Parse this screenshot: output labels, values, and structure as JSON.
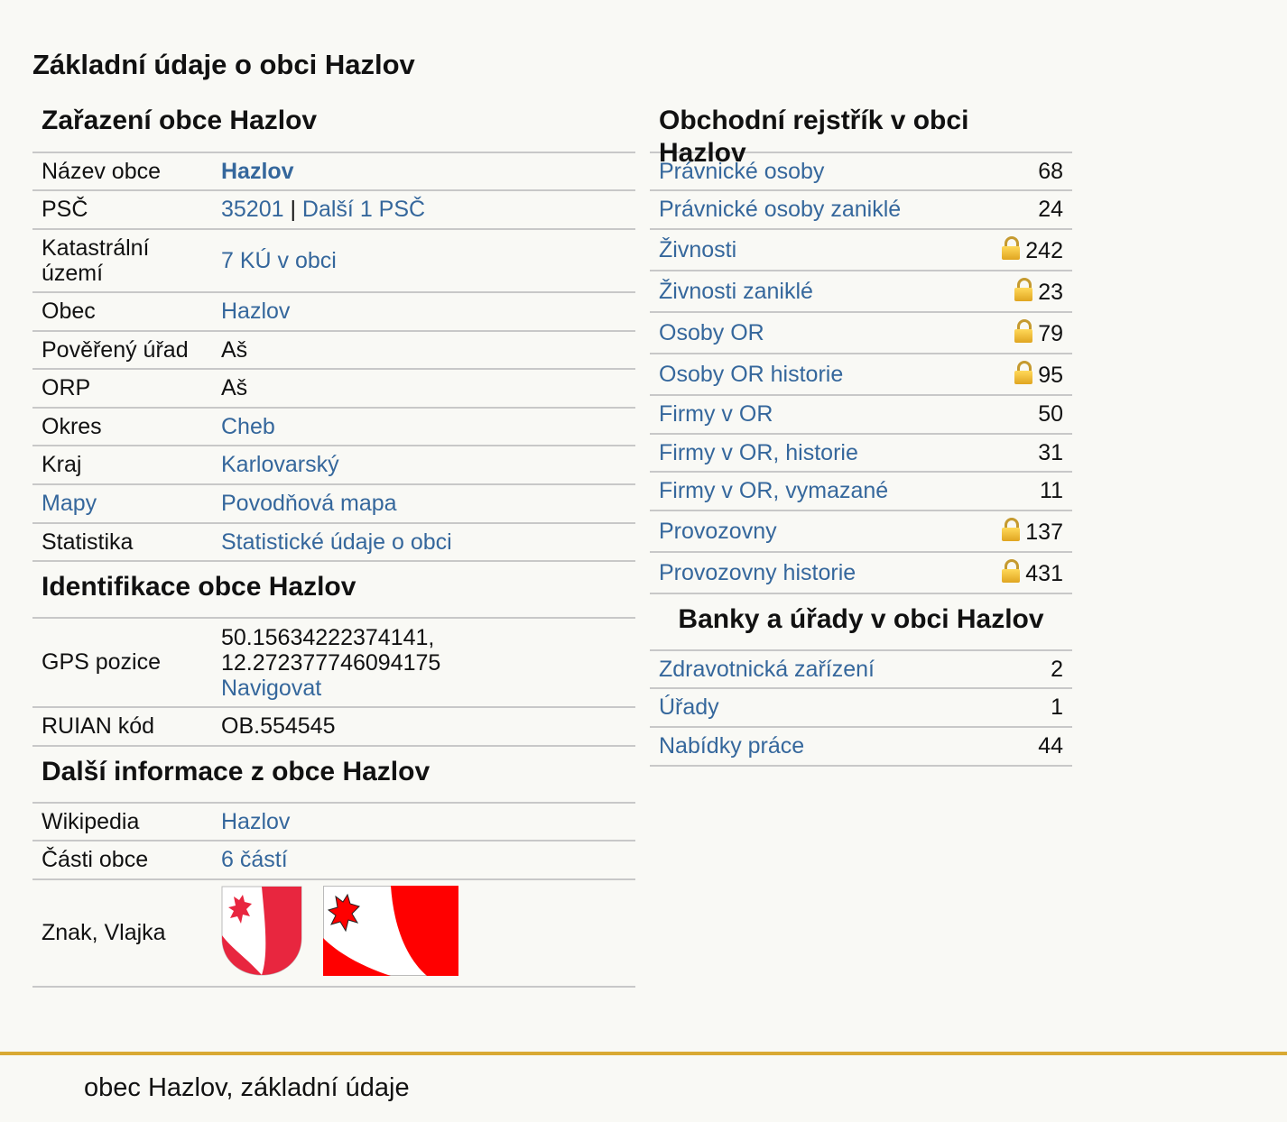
{
  "page_title": "Základní údaje o obci Hazlov",
  "zarazeni": {
    "title": "Zařazení obce Hazlov",
    "nazev_label": "Název obce",
    "nazev_value": "Hazlov",
    "psc_label": "PSČ",
    "psc_value": "35201",
    "psc_sep": " | ",
    "psc_more": "Další 1 PSČ",
    "ku_label": "Katastrální území",
    "ku_value": "7 KÚ v obci",
    "obec_label": "Obec",
    "obec_value": "Hazlov",
    "pou_label": "Pověřený úřad",
    "pou_value": "Aš",
    "orp_label": "ORP",
    "orp_value": "Aš",
    "okres_label": "Okres",
    "okres_value": "Cheb",
    "kraj_label": "Kraj",
    "kraj_value": "Karlovarský",
    "mapy_label": "Mapy",
    "mapy_value": "Povodňová mapa",
    "stat_label": "Statistika",
    "stat_value": "Statistické údaje o obci"
  },
  "identifikace": {
    "title": "Identifikace obce Hazlov",
    "gps_label": "GPS pozice",
    "gps_lat": "50.15634222374141,",
    "gps_lon": "12.272377746094175",
    "gps_nav": "Navigovat",
    "ruian_label": "RUIAN kód",
    "ruian_value": "OB.554545"
  },
  "dalsi": {
    "title": "Další informace z obce Hazlov",
    "wiki_label": "Wikipedia",
    "wiki_value": "Hazlov",
    "casti_label": "Části obce",
    "casti_value": "6 částí",
    "znak_label": "Znak, Vlajka"
  },
  "registr": {
    "title": "Obchodní rejstřík v obci Hazlov",
    "rows": [
      {
        "label": "Právnické osoby",
        "value": "68",
        "locked": false
      },
      {
        "label": "Právnické osoby zaniklé",
        "value": "24",
        "locked": false
      },
      {
        "label": "Živnosti",
        "value": "242",
        "locked": true
      },
      {
        "label": "Živnosti zaniklé",
        "value": "23",
        "locked": true
      },
      {
        "label": "Osoby OR",
        "value": "79",
        "locked": true
      },
      {
        "label": "Osoby OR historie",
        "value": "95",
        "locked": true
      },
      {
        "label": "Firmy v OR",
        "value": "50",
        "locked": false
      },
      {
        "label": "Firmy v OR, historie",
        "value": "31",
        "locked": false
      },
      {
        "label": "Firmy v OR, vymazané",
        "value": "11",
        "locked": false
      },
      {
        "label": "Provozovny",
        "value": "137",
        "locked": true
      },
      {
        "label": "Provozovny historie",
        "value": "431",
        "locked": true
      }
    ]
  },
  "banky": {
    "title": "Banky a úřady v obci Hazlov",
    "rows": [
      {
        "label": "Zdravotnická zařízení",
        "value": "2"
      },
      {
        "label": "Úřady",
        "value": "1"
      },
      {
        "label": "Nabídky práce",
        "value": "44"
      }
    ]
  },
  "footer_text": "obec Hazlov, základní údaje",
  "colors": {
    "link": "#35679c",
    "footer_rule": "#d9a933",
    "emblem_red": "#e8263f",
    "flag_red": "#ff0000"
  }
}
